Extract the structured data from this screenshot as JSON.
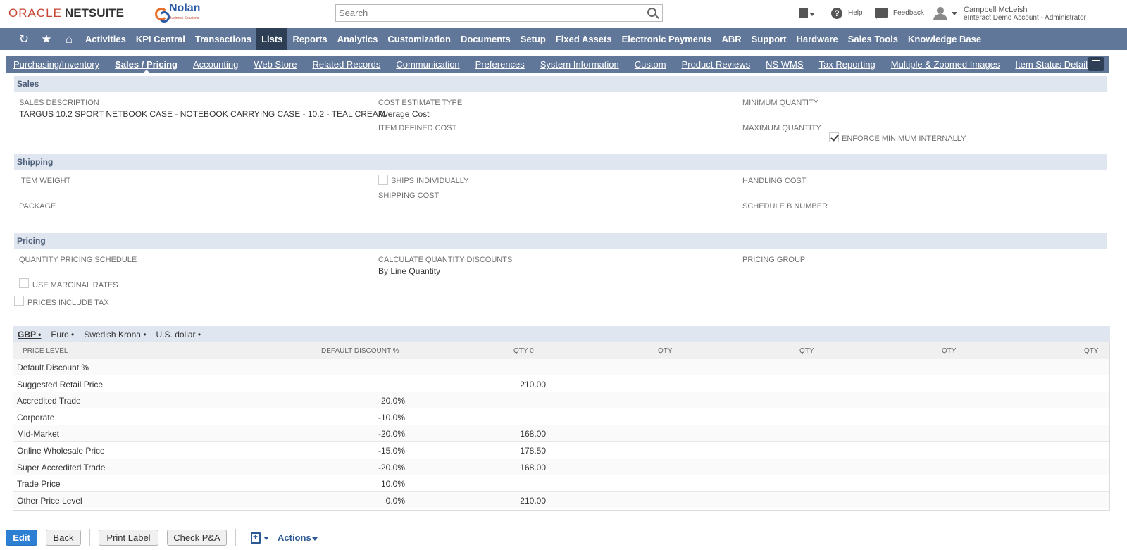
{
  "header": {
    "brand_oracle": "ORACLE",
    "brand_netsuite": "NETSUITE",
    "partner_logo": "Nolan",
    "partner_sub": "Business Solutions",
    "search_placeholder": "Search",
    "help_label": "Help",
    "feedback_label": "Feedback",
    "user_name": "Campbell McLeish",
    "user_role": "eInteract Demo Account - Administrator",
    "icons": [
      "recent-records-icon",
      "help-icon",
      "feedback-icon",
      "user-avatar-icon"
    ]
  },
  "main_nav": {
    "icons": [
      "recent-icon",
      "star-icon",
      "home-icon"
    ],
    "items": [
      "Activities",
      "KPI Central",
      "Transactions",
      "Lists",
      "Reports",
      "Analytics",
      "Customization",
      "Documents",
      "Setup",
      "Fixed Assets",
      "Electronic Payments",
      "ABR",
      "Support",
      "Hardware",
      "Sales Tools",
      "Knowledge Base"
    ],
    "active": "Lists"
  },
  "subtabs": {
    "items": [
      "Purchasing/Inventory",
      "Sales / Pricing",
      "Accounting",
      "Web Store",
      "Related Records",
      "Communication",
      "Preferences",
      "System Information",
      "Custom",
      "Product Reviews",
      "NS WMS",
      "Tax Reporting",
      "Multiple & Zoomed Images",
      "Item Status Details"
    ],
    "active": "Sales / Pricing"
  },
  "sales": {
    "title": "Sales",
    "sales_description_label": "SALES DESCRIPTION",
    "sales_description_value": "TARGUS 10.2 SPORT NETBOOK CASE - NOTEBOOK CARRYING CASE - 10.2 - TEAL CREAM",
    "cost_estimate_type_label": "COST ESTIMATE TYPE",
    "cost_estimate_type_value": "Average Cost",
    "item_defined_cost_label": "ITEM DEFINED COST",
    "minimum_quantity_label": "MINIMUM QUANTITY",
    "maximum_quantity_label": "MAXIMUM QUANTITY",
    "enforce_minimum_label": "ENFORCE MINIMUM INTERNALLY",
    "enforce_minimum_checked": true
  },
  "shipping": {
    "title": "Shipping",
    "item_weight_label": "ITEM WEIGHT",
    "package_label": "PACKAGE",
    "ships_individually_label": "SHIPS INDIVIDUALLY",
    "shipping_cost_label": "SHIPPING COST",
    "handling_cost_label": "HANDLING COST",
    "schedule_b_label": "SCHEDULE B NUMBER"
  },
  "pricing": {
    "title": "Pricing",
    "qty_pricing_schedule_label": "QUANTITY PRICING SCHEDULE",
    "use_marginal_rates_label": "USE MARGINAL RATES",
    "prices_include_tax_label": "PRICES INCLUDE TAX",
    "calc_qty_discounts_label": "CALCULATE QUANTITY DISCOUNTS",
    "calc_qty_discounts_value": "By Line Quantity",
    "pricing_group_label": "PRICING GROUP"
  },
  "currencies": {
    "items": [
      "GBP",
      "Euro",
      "Swedish Krona",
      "U.S. dollar"
    ],
    "active": "GBP",
    "separator": "•"
  },
  "price_table": {
    "headers": [
      "PRICE LEVEL",
      "DEFAULT DISCOUNT %",
      "QTY 0",
      "QTY",
      "QTY",
      "QTY",
      "QTY"
    ],
    "rows": [
      {
        "level": "Default Discount %",
        "discount": "",
        "qty0": ""
      },
      {
        "level": "Suggested Retail Price",
        "discount": "",
        "qty0": "210.00"
      },
      {
        "level": "Accredited Trade",
        "discount": "20.0%",
        "qty0": ""
      },
      {
        "level": "Corporate",
        "discount": "-10.0%",
        "qty0": ""
      },
      {
        "level": "Mid-Market",
        "discount": "-20.0%",
        "qty0": "168.00"
      },
      {
        "level": "Online Wholesale Price",
        "discount": "-15.0%",
        "qty0": "178.50"
      },
      {
        "level": "Super Accredited Trade",
        "discount": "-20.0%",
        "qty0": "168.00"
      },
      {
        "level": "Trade Price",
        "discount": "10.0%",
        "qty0": ""
      },
      {
        "level": "Other Price Level",
        "discount": "0.0%",
        "qty0": "210.00"
      }
    ]
  },
  "footer": {
    "edit_label": "Edit",
    "back_label": "Back",
    "print_label_label": "Print Label",
    "check_pa_label": "Check P&A",
    "actions_label": "Actions"
  },
  "colors": {
    "nav_bg": "#607799",
    "nav_active": "#2d3e55",
    "section_bg": "#e0e6ef",
    "primary_button": "#2d7fd3"
  }
}
